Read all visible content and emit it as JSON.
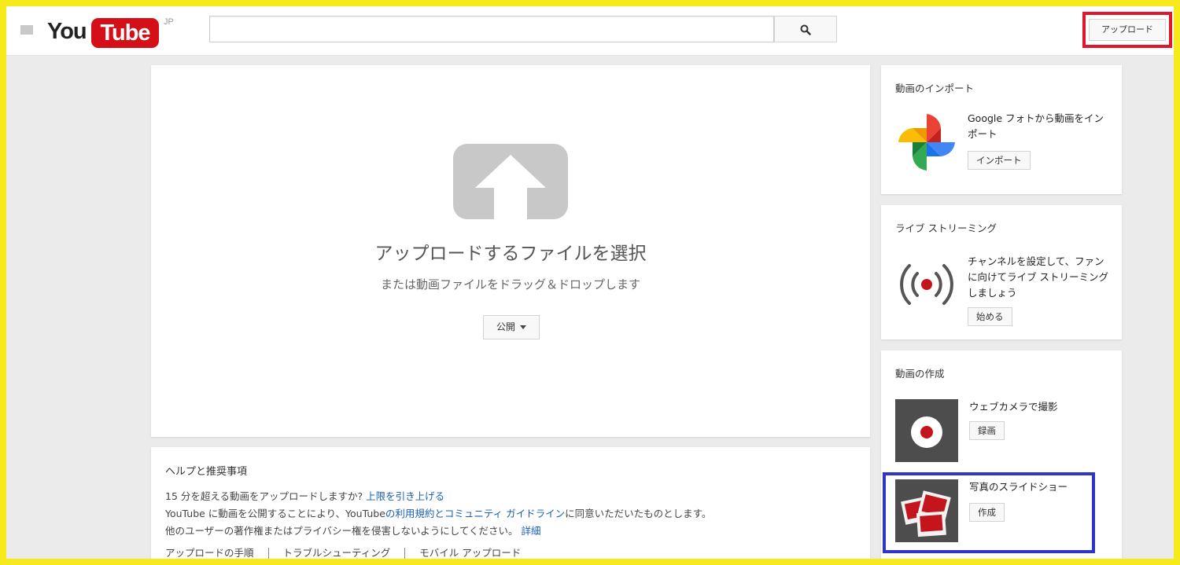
{
  "header": {
    "logo_you": "You",
    "logo_tube": "Tube",
    "logo_region": "JP",
    "search_placeholder": "",
    "upload_label": "アップロード"
  },
  "upload": {
    "title": "アップロードするファイルを選択",
    "subtitle": "または動画ファイルをドラッグ＆ドロップします",
    "privacy_value": "公開"
  },
  "help": {
    "title": "ヘルプと推奨事項",
    "line1_text": "15 分を超える動画をアップロードしますか?",
    "line1_link": "上限を引き上げる",
    "line2_pre": "YouTube に動画を公開することにより、YouTube",
    "line2_link": "の利用規約とコミュニティ ガイドライン",
    "line2_post": "に同意いただいたものとします。",
    "line3_text": "他のユーザーの著作権またはプライバシー権を侵害しないようにしてください。",
    "line3_link": "詳細",
    "footer_links": [
      "アップロードの手順",
      "トラブルシューティング",
      "モバイル アップロード"
    ]
  },
  "sidebar": {
    "import": {
      "title": "動画のインポート",
      "text": "Google フォトから動画をインポート",
      "button": "インポート"
    },
    "live": {
      "title": "ライブ ストリーミング",
      "text": "チャンネルを設定して、ファンに向けてライブ ストリーミングしましょう",
      "button": "始める"
    },
    "create": {
      "title": "動画の作成",
      "webcam_text": "ウェブカメラで撮影",
      "webcam_button": "録画",
      "slideshow_text": "写真のスライドショー",
      "slideshow_button": "作成"
    }
  },
  "colors": {
    "highlight_yellow": "#f7ea1c",
    "highlight_red": "#e0162b",
    "highlight_blue": "#2f36c7",
    "youtube_red": "#d40f17",
    "link_blue": "#1a5fb4"
  }
}
